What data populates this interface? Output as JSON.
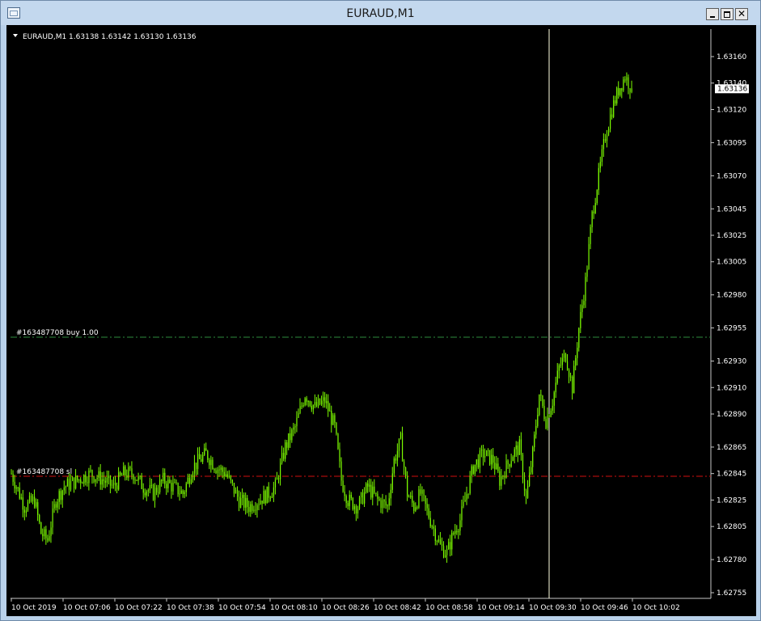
{
  "window": {
    "title": "EURAUD,M1",
    "minimize_icon": "minimize-icon",
    "maximize_icon": "maximize-icon",
    "close_icon": "close-icon",
    "close_glyph": "✕"
  },
  "chart_header": {
    "collapse_icon": "triangle-down-icon",
    "text": "EURAUD,M1  1.63138 1.63142 1.63130 1.63136"
  },
  "price_marker": "1.63136",
  "orders": {
    "buy_label": "#163487708 buy 1.00",
    "sl_label": "#163487708 sl"
  },
  "colors": {
    "background": "#000000",
    "candle": "#7cfc00",
    "buy_line": "#2e8b3e",
    "sl_line": "#d01010",
    "crosshair": "#ffffe0",
    "text": "#ffffff"
  },
  "chart_data": {
    "type": "candlestick",
    "symbol": "EURAUD",
    "timeframe": "M1",
    "y_ticks": [
      "1.63160",
      "1.63140",
      "1.63120",
      "1.63095",
      "1.63070",
      "1.63045",
      "1.63025",
      "1.63005",
      "1.62980",
      "1.62955",
      "1.62930",
      "1.62910",
      "1.62890",
      "1.62865",
      "1.62845",
      "1.62825",
      "1.62805",
      "1.62780",
      "1.62755"
    ],
    "x_ticks": [
      "10 Oct 2019",
      "10 Oct 07:06",
      "10 Oct 07:22",
      "10 Oct 07:38",
      "10 Oct 07:54",
      "10 Oct 08:10",
      "10 Oct 08:26",
      "10 Oct 08:42",
      "10 Oct 08:58",
      "10 Oct 09:14",
      "10 Oct 09:30",
      "10 Oct 09:46",
      "10 Oct 10:02"
    ],
    "ylim": [
      1.62755,
      1.6316
    ],
    "last_price": 1.63136,
    "buy_level": 1.62948,
    "sl_level": 1.62843,
    "crosshair_time": "10 Oct 09:30",
    "close_path": [
      [
        0,
        1.62845
      ],
      [
        8,
        1.6282
      ],
      [
        14,
        1.62825
      ],
      [
        18,
        1.628
      ],
      [
        22,
        1.62795
      ],
      [
        27,
        1.62825
      ],
      [
        32,
        1.62835
      ],
      [
        40,
        1.6284
      ],
      [
        48,
        1.62845
      ],
      [
        56,
        1.6284
      ],
      [
        62,
        1.62835
      ],
      [
        68,
        1.62845
      ],
      [
        74,
        1.62845
      ],
      [
        80,
        1.62835
      ],
      [
        86,
        1.6283
      ],
      [
        92,
        1.6284
      ],
      [
        98,
        1.62835
      ],
      [
        104,
        1.6283
      ],
      [
        110,
        1.6285
      ],
      [
        118,
        1.6286
      ],
      [
        124,
        1.6285
      ],
      [
        130,
        1.62845
      ],
      [
        134,
        1.62835
      ],
      [
        138,
        1.62825
      ],
      [
        144,
        1.6282
      ],
      [
        150,
        1.62825
      ],
      [
        156,
        1.6283
      ],
      [
        160,
        1.62835
      ],
      [
        166,
        1.62865
      ],
      [
        172,
        1.6288
      ],
      [
        178,
        1.62905
      ],
      [
        184,
        1.62895
      ],
      [
        190,
        1.629
      ],
      [
        196,
        1.6288
      ],
      [
        200,
        1.6284
      ],
      [
        204,
        1.62825
      ],
      [
        210,
        1.6282
      ],
      [
        216,
        1.62835
      ],
      [
        222,
        1.62825
      ],
      [
        228,
        1.6282
      ],
      [
        232,
        1.62855
      ],
      [
        236,
        1.6287
      ],
      [
        240,
        1.6283
      ],
      [
        244,
        1.6282
      ],
      [
        248,
        1.6283
      ],
      [
        254,
        1.6281
      ],
      [
        260,
        1.6279
      ],
      [
        264,
        1.62785
      ],
      [
        268,
        1.628
      ],
      [
        272,
        1.6281
      ],
      [
        276,
        1.6283
      ],
      [
        280,
        1.6285
      ],
      [
        286,
        1.6286
      ],
      [
        292,
        1.62855
      ],
      [
        296,
        1.6284
      ],
      [
        300,
        1.6285
      ],
      [
        304,
        1.6286
      ],
      [
        308,
        1.62865
      ],
      [
        312,
        1.62825
      ],
      [
        316,
        1.6286
      ],
      [
        320,
        1.62905
      ],
      [
        324,
        1.62885
      ],
      [
        328,
        1.629
      ],
      [
        332,
        1.62925
      ],
      [
        336,
        1.62935
      ],
      [
        340,
        1.6291
      ],
      [
        344,
        1.62955
      ],
      [
        348,
        1.6299
      ],
      [
        352,
        1.6304
      ],
      [
        356,
        1.6307
      ],
      [
        360,
        1.631
      ],
      [
        364,
        1.6312
      ],
      [
        368,
        1.63135
      ],
      [
        372,
        1.63145
      ],
      [
        376,
        1.63136
      ]
    ]
  }
}
